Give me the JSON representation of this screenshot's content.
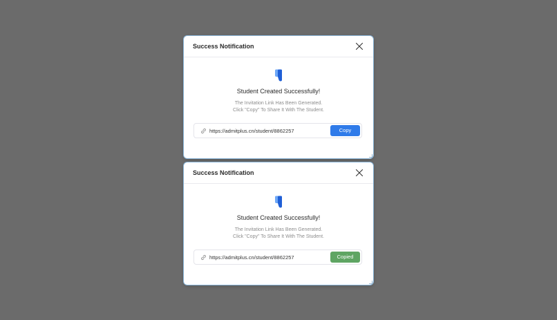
{
  "colors": {
    "overlay": "#6b6b6b",
    "copy_button": "#2f7be9",
    "copied_button": "#5fa563",
    "brand_icon_dark": "#1f5fd6",
    "brand_icon_light": "#6ea8f7"
  },
  "dialogs": [
    {
      "title": "Success Notification",
      "close_icon": "close-icon",
      "brand_icon": "admitplus-logo-icon",
      "headline": "Student Created Successfully!",
      "description_line1": "The Invitation Link Has Been Generated.",
      "description_line2": "Click \"Copy\" To Share It With The Student.",
      "link_icon": "link-icon",
      "link_url": "https://admitplus.cn/student/8862257",
      "button_label": "Copy",
      "button_state": "default"
    },
    {
      "title": "Success Notification",
      "close_icon": "close-icon",
      "brand_icon": "admitplus-logo-icon",
      "headline": "Student Created Successfully!",
      "description_line1": "The Invitation Link Has Been Generated.",
      "description_line2": "Click \"Copy\" To Share It With The Student.",
      "link_icon": "link-icon",
      "link_url": "https://admitplus.cn/student/8862257",
      "button_label": "Copied",
      "button_state": "copied"
    }
  ]
}
